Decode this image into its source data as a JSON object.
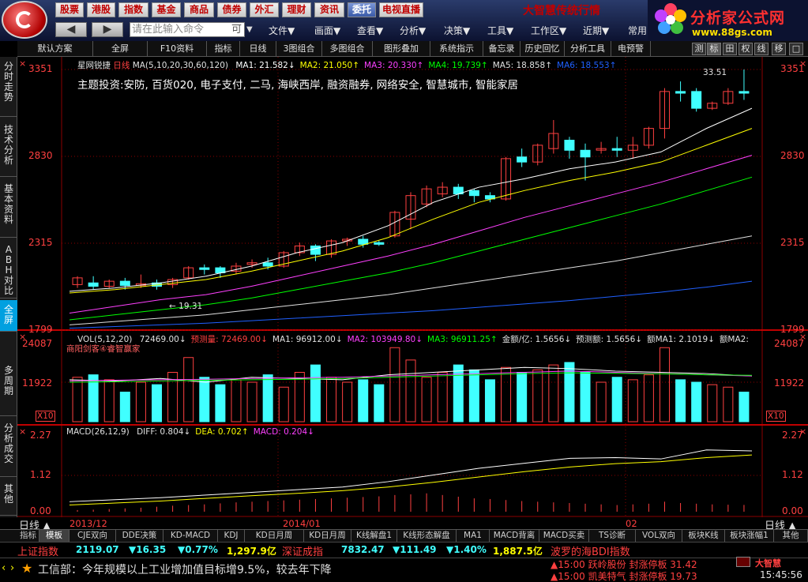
{
  "topmenu": {
    "items": [
      "股票",
      "港股",
      "指数",
      "基金",
      "商品",
      "债券",
      "外汇",
      "理财",
      "资讯",
      "委托",
      "电视直播"
    ],
    "active_index": 9,
    "brand_title": "大智慧传统行情"
  },
  "command": {
    "placeholder": "请在此输入命令",
    "hint": "可",
    "menus": [
      "文件▼",
      "画面▼",
      "查看▼",
      "分析▼",
      "决策▼",
      "工具▼",
      "工作区▼",
      "近期▼",
      "常用"
    ]
  },
  "brand": {
    "name": "分析家公式网",
    "url": "www.88gs.com"
  },
  "toolbar": {
    "items": [
      "默认方案",
      "全屏",
      "F10资料",
      "指标",
      "日线",
      "3图组合",
      "多图组合",
      "图形叠加",
      "系统指示",
      "备忘录",
      "历史回忆",
      "分析工具",
      "电预警"
    ],
    "right_buttons": [
      "测",
      "标",
      "田",
      "权",
      "线",
      "移",
      "□"
    ]
  },
  "sidebar": {
    "tabs": [
      "分时走势",
      "技术分析",
      "基本资料",
      "ABH对比",
      "全屏",
      "多周期",
      "分析成交",
      "其他"
    ],
    "selected": 4
  },
  "main_chart": {
    "stock_name": "星网锐捷",
    "period": "日线",
    "ma_params": "MA(5,10,20,30,60,120)",
    "ma_values": [
      {
        "label": "MA1: 21.582↓",
        "color": "#ffffff"
      },
      {
        "label": "MA2: 21.050↑",
        "color": "#ffff00"
      },
      {
        "label": "MA3: 20.330↑",
        "color": "#ff40ff"
      },
      {
        "label": "MA4: 19.739↑",
        "color": "#00ff00"
      },
      {
        "label": "MA5: 18.858↑",
        "color": "#e0e0e0"
      },
      {
        "label": "MA6: 18.553↑",
        "color": "#2060ff"
      }
    ],
    "theme_text": "主题投资:安防, 百货020, 电子支付, 二马, 海峡西岸, 融资融券, 网络安全, 智慧城市, 智能家居",
    "y_ticks": [
      "3351",
      "2830",
      "2315",
      "1799"
    ],
    "high_label": "33.51",
    "low_label": "19.31"
  },
  "volume_chart": {
    "header": "VOL(5,12,20)",
    "items": [
      {
        "label": "72469.00↓",
        "color": "#e0e0e0"
      },
      {
        "label": "预测量: 72469.00↓",
        "color": "#ff4040"
      },
      {
        "label": "MA1: 96912.00↓",
        "color": "#e0e0e0"
      },
      {
        "label": "MA2: 103949.80↓",
        "color": "#ff40ff"
      },
      {
        "label": "MA3: 96911.25↑",
        "color": "#00ff00"
      },
      {
        "label": "金额/亿: 1.5656↓",
        "color": "#e0e0e0"
      },
      {
        "label": "预测额: 1.5656↓",
        "color": "#e0e0e0"
      },
      {
        "label": "额MA1: 2.1019↓",
        "color": "#e0e0e0"
      },
      {
        "label": "额MA2:",
        "color": "#e0e0e0"
      }
    ],
    "sub_label": "商阳剑客④睿智赢家",
    "y_ticks": [
      "24087",
      "11922"
    ],
    "unit_label": "X10"
  },
  "macd_chart": {
    "header": "MACD(26,12,9)",
    "items": [
      {
        "label": "DIFF: 0.804↓",
        "color": "#e0e0e0"
      },
      {
        "label": "DEA: 0.702↑",
        "color": "#ffff00"
      },
      {
        "label": "MACD: 0.204↓",
        "color": "#ff40ff"
      }
    ],
    "y_ticks": [
      "2.27",
      "1.12",
      "0.00"
    ]
  },
  "time_axis": {
    "period_label": "日线",
    "labels": [
      "2013/12",
      "2014/01",
      "02"
    ]
  },
  "bottom_tabs": [
    "指标",
    "模板",
    "CJE双向",
    "DDE决策",
    "KD-MACD",
    "KDJ",
    "KD日月周",
    "KD日月周",
    "K线解盘1",
    "K线形态解盘",
    "MA1",
    "MACD背离",
    "MACD买卖",
    "TS诊断",
    "VOL双向",
    "板块K线",
    "板块涨幅1",
    "其他"
  ],
  "index_bar": {
    "sh_name": "上证指数",
    "sh_value": "2119.07",
    "sh_change": "▼16.35",
    "sh_pct": "▼0.77%",
    "sh_amount": "1,297.9亿",
    "sz_name": "深证成指",
    "sz_value": "7832.47",
    "sz_change": "▼111.49",
    "sz_pct": "▼1.40%",
    "sz_amount": "1,887.5亿",
    "ticker": "波罗的海BDI指数"
  },
  "news_bar": {
    "headline": "工信部：今年规模以上工业增加值目标增9.5%，较去年下降",
    "alert1": "▲15:00 跃岭股份 封涨停板 31.42",
    "alert2": "▲15:00 凯美特气 封涨停板 19.73",
    "clock": "15:45:56",
    "logo": "大智慧"
  },
  "colors": {
    "up": "#ff4040",
    "down": "#40ffff",
    "grid": "#8b0000"
  }
}
